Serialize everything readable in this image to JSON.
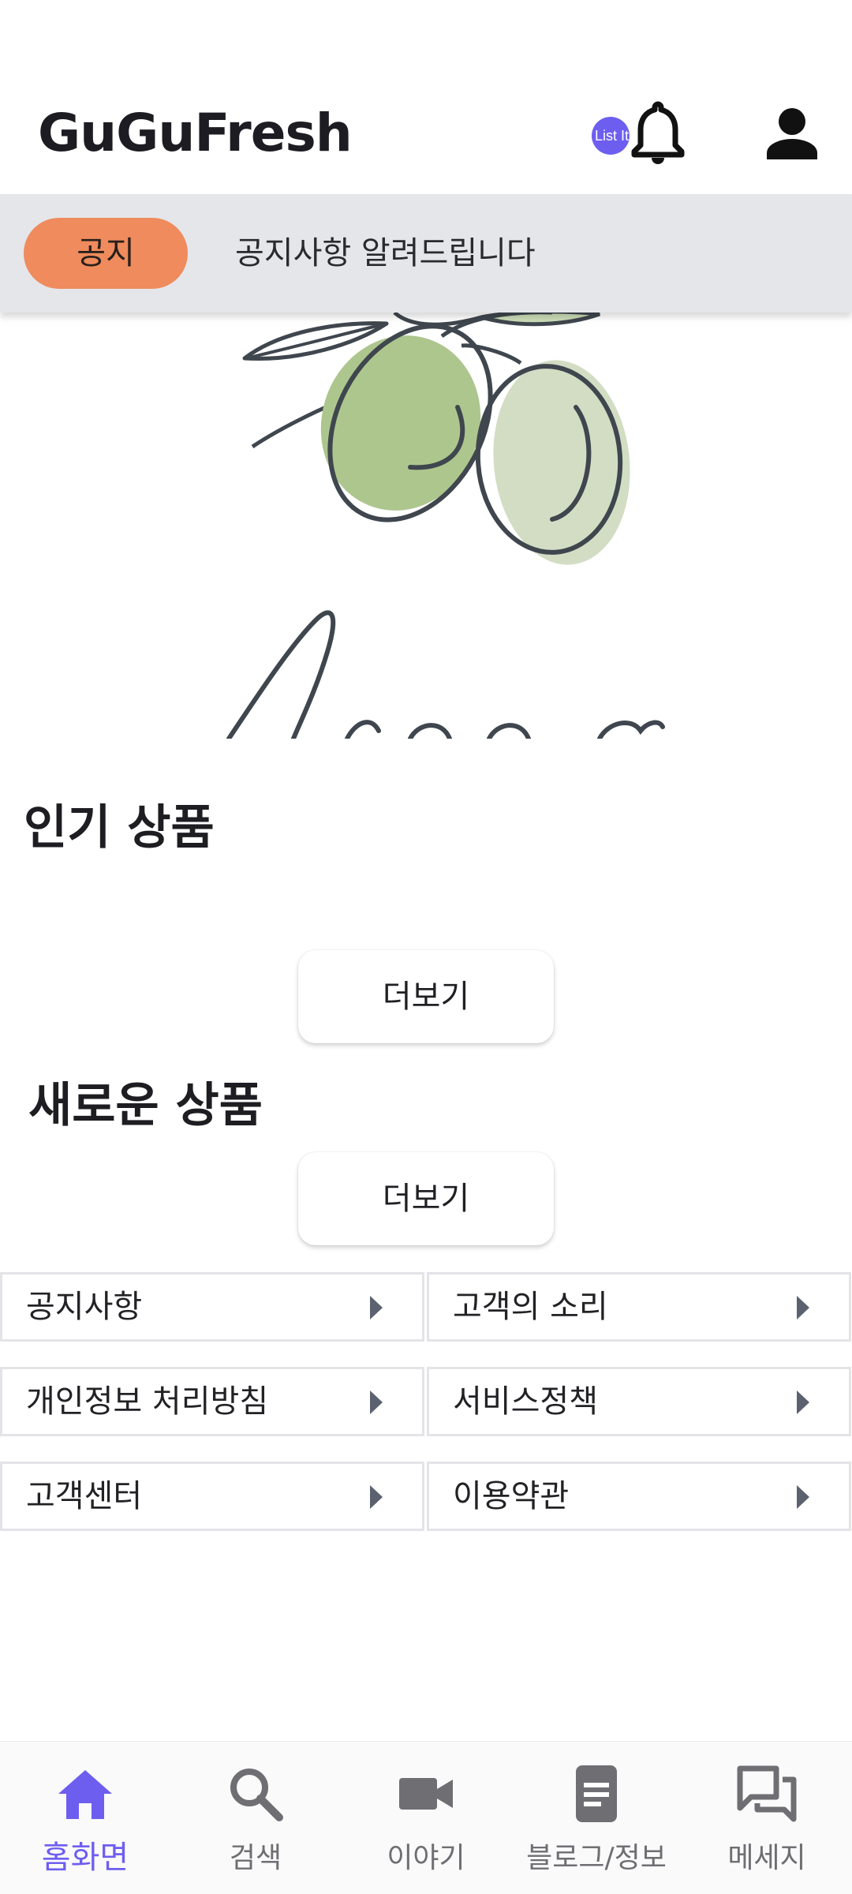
{
  "app": {
    "title": "GuGuFresh"
  },
  "header": {
    "logo": "GuGuFresh",
    "badge": "List Ite",
    "bell_icon": "bell-icon",
    "profile_icon": "person-icon"
  },
  "notice": {
    "tag": "공지",
    "text": "공지사항 알려드립니다"
  },
  "sections": {
    "popular": {
      "title": "인기 상품",
      "more": "더보기"
    },
    "new": {
      "title": "새로운 상품",
      "more": "더보기"
    }
  },
  "links": [
    {
      "label": "공지사항"
    },
    {
      "label": "고객의 소리"
    },
    {
      "label": "개인정보 처리방침"
    },
    {
      "label": "서비스정책"
    },
    {
      "label": "고객센터"
    },
    {
      "label": "이용약관"
    }
  ],
  "bottom_nav": [
    {
      "label": "홈화면",
      "icon": "home-icon",
      "active": true
    },
    {
      "label": "검색",
      "icon": "search-icon",
      "active": false
    },
    {
      "label": "이야기",
      "icon": "video-icon",
      "active": false
    },
    {
      "label": "블로그/정보",
      "icon": "document-icon",
      "active": false
    },
    {
      "label": "메세지",
      "icon": "chat-icon",
      "active": false
    }
  ],
  "colors": {
    "accent": "#6d5ef0",
    "notice_pill": "#ef8b5d",
    "notice_bar": "#e5e6ea",
    "nav_inactive": "#6e6e73"
  }
}
